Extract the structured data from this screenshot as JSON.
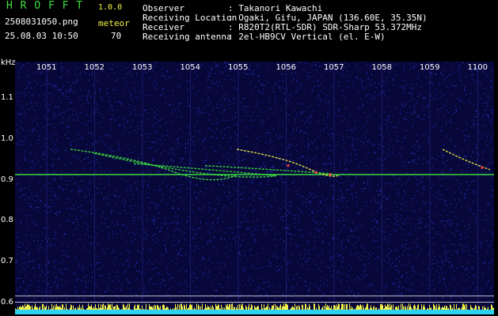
{
  "header": {
    "app_title": "H R O F F T",
    "version": "1.0.0",
    "filename": "2508031050.png",
    "datetime": "25.08.03 10:50",
    "meteor_label": "meteor",
    "meteor_count": "70",
    "rows": [
      {
        "label": "Observer",
        "value": ": Takanori Kawachi"
      },
      {
        "label": "Receiving Location",
        "value": ": Ogaki, Gifu, JAPAN (136.60E, 35.35N)"
      },
      {
        "label": "Receiver",
        "value": ": R820T2(RTL-SDR) SDR-Sharp 53.372MHz"
      },
      {
        "label": "Receiving antenna",
        "value": ": 2el-HB9CV Vertical (el. E-W)"
      }
    ]
  },
  "chart_data": {
    "type": "heatmap",
    "ylabel": "kHz",
    "x_ticks": [
      "1051",
      "1052",
      "1053",
      "1054",
      "1055",
      "1056",
      "1057",
      "1058",
      "1059",
      "1100"
    ],
    "y_ticks": [
      "1.1",
      "1.0",
      "0.9",
      "0.8",
      "0.7",
      "0.6"
    ],
    "ylim": [
      0.57,
      1.19
    ],
    "carrier_khz": 0.913,
    "colors": {
      "background": "#07073a",
      "noise": "#2a3fd0",
      "trail": "#3fe03f",
      "trail_hot": "#f2f24a",
      "trail_peak": "#ff4040",
      "level_bars": "#f2f24a",
      "level_base": "#2fd0f0"
    }
  }
}
